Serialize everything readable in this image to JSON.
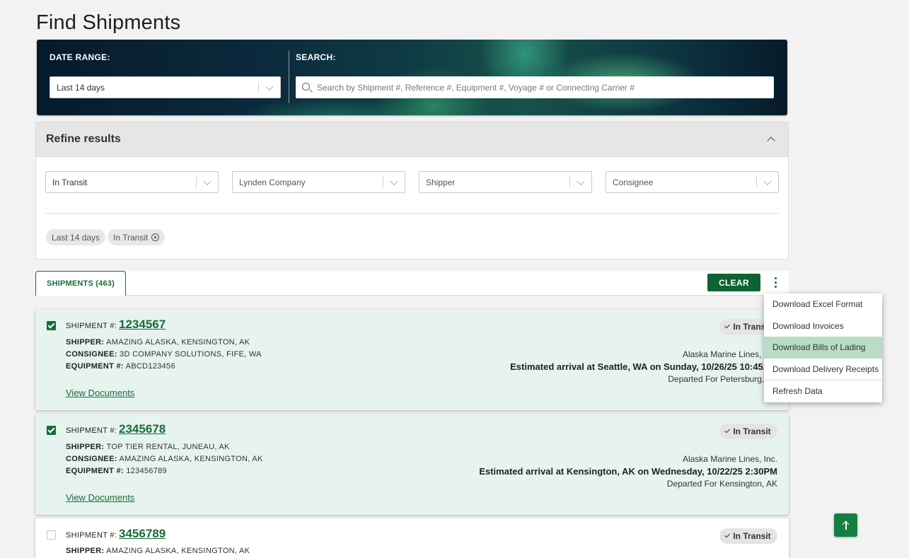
{
  "page": {
    "title": "Find Shipments"
  },
  "hero": {
    "date_range_label": "DATE RANGE:",
    "date_range_value": "Last 14 days",
    "search_label": "SEARCH:",
    "search_placeholder": "Search by Shipment #, Reference #, Equipment #, Voyage # or Connecting Carrier #"
  },
  "refine": {
    "title": "Refine results",
    "filters": [
      "In Transit",
      "Lynden Company",
      "Shipper",
      "Consignee"
    ],
    "chips": [
      "Last 14 days",
      "In Transit"
    ]
  },
  "toolbar": {
    "tab_label": "SHIPMENTS (463)",
    "clear_label": "CLEAR"
  },
  "menu": {
    "items": [
      "Download Excel Format",
      "Download Invoices",
      "Download Bills of Lading",
      "Download Delivery Receipts",
      "Refresh Data"
    ]
  },
  "labels": {
    "shipment": "SHIPMENT #:",
    "shipper": "SHIPPER:",
    "consignee": "CONSIGNEE:",
    "equipment": "EQUIPMENT #:",
    "view_documents": "View Documents"
  },
  "shipments": [
    {
      "number": "1234567",
      "checked": true,
      "shipper": "AMAZING ALASKA, KENSINGTON, AK",
      "consignee": "3D COMPANY SOLUTIONS, FIFE, WA",
      "equipment": "ABCD123456",
      "status": "In Transit",
      "carrier": "Alaska Marine Lines, Inc.",
      "eta": "Estimated arrival at Seattle, WA on Sunday, 10/26/25 10:45AM",
      "departed": "Departed For Petersburg, AK"
    },
    {
      "number": "2345678",
      "checked": true,
      "shipper": "TOP TIER RENTAL, JUNEAU, AK",
      "consignee": "AMAZING ALASKA, KENSINGTON, AK",
      "equipment": "123456789",
      "status": "In Transit",
      "carrier": "Alaska Marine Lines, Inc.",
      "eta": "Estimated arrival at Kensington, AK on Wednesday, 10/22/25 2:30PM",
      "departed": "Departed For Kensington, AK"
    },
    {
      "number": "3456789",
      "checked": false,
      "shipper": "AMAZING ALASKA, KENSINGTON, AK",
      "status": "In Transit"
    }
  ]
}
